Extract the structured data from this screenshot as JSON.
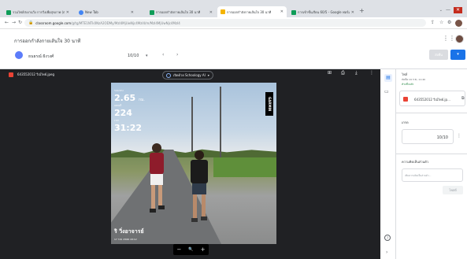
{
  "browser": {
    "tabs": [
      {
        "title": "รวมไฟล์ส่งงานวิ่ง การวิ่งเพื่อสุขภาพ (ตอบกลับ)",
        "favicon_color": "#0f9d58"
      },
      {
        "title": "New Tab",
        "favicon_color": "#4285f4"
      },
      {
        "title": "การออกกำลังกายเส้นใจ 30 นาที",
        "favicon_color": "#0f9d58"
      },
      {
        "title": "การออกกำลังกายเส้นใจ 30 นาที",
        "favicon_color": "#f4b400"
      },
      {
        "title": "การเข้าชั้นเรียน 60/5 - Google ฟอร์ม",
        "favicon_color": "#0f9d58"
      }
    ],
    "active_tab": 3,
    "url_host": "classroom.google.com",
    "url_path": "/g/tg/MTE1NTk0NzA2ODMy/MzI4MjUwNjc4MzI4/m/MzI4MjUwNjc4MzI4",
    "newtab_glyph": "+",
    "min_glyph": "—",
    "dropdown_glyph": "⌄",
    "close_glyph": "✕",
    "close_color": "#c42b1c"
  },
  "app": {
    "assignment_title": "การออกกำลังกายเส้นใจ 30 นาที",
    "student_name": "ธนธรณ์ ฝังวงศ์",
    "grade_value": "10/10",
    "return_label": "ส่งคืน",
    "dropdown_glyph": "▾",
    "prev_glyph": "‹",
    "next_glyph": "›",
    "accent_color": "#1a73e8"
  },
  "viewer": {
    "file_name": "643552012 วีณ์ไทย์.jpeg",
    "open_with_label": "เปิดด้วย Schoology AI",
    "photo": {
      "distance": "2.65",
      "distance_unit": "กม.",
      "distance_label": "ระยะทาง",
      "pace": "224",
      "pace_label": "แคลอรี่",
      "time": "31:22",
      "time_label": "เวลา",
      "brand": "GARMIN",
      "caption": "ริ วิ่งอาจารย์",
      "caption_sub": "17 ก.พ. 2566 18:12"
    },
    "zoom_out_glyph": "−",
    "zoom_glyph": "🔍",
    "zoom_in_glyph": "+"
  },
  "panel": {
    "files_header": "ไฟล์",
    "due_line": "ส่งเมื่อ 19 ก.พ., 11:40",
    "turned_in": "ทำเสร็จแล้ว",
    "file_card_name": "643552012 วีณ์ไทย์.jp...",
    "grade_label": "เกรด",
    "grade_value": "10/10",
    "private_comment_label": "ความคิดเห็นส่วนตัว",
    "private_comment_placeholder": "เพิ่มความคิดเห็นส่วนตัว...",
    "post_label": "โพสต์"
  }
}
